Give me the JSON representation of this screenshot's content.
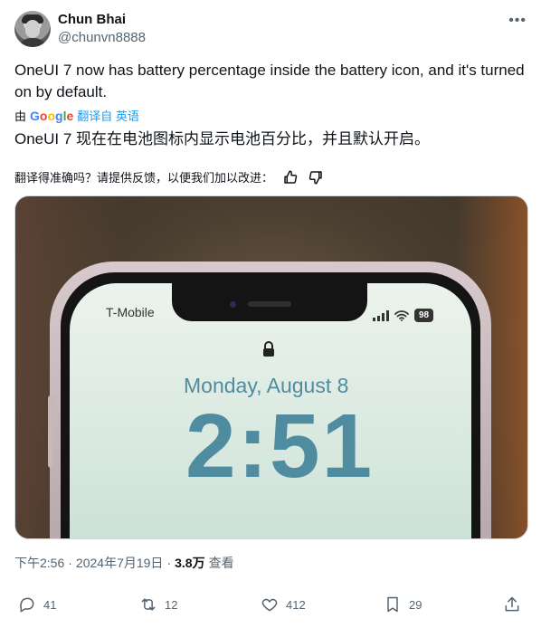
{
  "author": {
    "display_name": "Chun Bhai",
    "handle": "@chunvn8888"
  },
  "post": {
    "text_en": "OneUI 7 now has battery percentage inside the battery icon, and it's turned on by default.",
    "translated_by_prefix": "由",
    "translated_by_engine_letters": [
      "G",
      "o",
      "o",
      "g",
      "l",
      "e"
    ],
    "translated_from": "翻译自 英语",
    "text_zh": "OneUI 7 现在在电池图标内显示电池百分比，并且默认开启。",
    "feedback_prompt": "翻译得准确吗？请提供反馈，以便我们加以改进："
  },
  "media": {
    "carrier": "T-Mobile",
    "battery_percent": "98",
    "lock_date": "Monday, August 8",
    "lock_time": "2:51"
  },
  "meta": {
    "time": "下午2:56",
    "sep1": "·",
    "date": "2024年7月19日",
    "sep2": "·",
    "views_count": "3.8万",
    "views_label": "查看"
  },
  "actions": {
    "replies": "41",
    "reposts": "12",
    "likes": "412",
    "bookmarks": "29"
  },
  "colors": {
    "accent": "#1d9bf0",
    "secondary_text": "#536471",
    "primary_text": "#0f1419"
  },
  "icons": {
    "more": "more-dots-icon",
    "thumbs_up": "thumbs-up-icon",
    "thumbs_down": "thumbs-down-icon",
    "reply": "reply-icon",
    "repost": "repost-icon",
    "like": "heart-icon",
    "bookmark": "bookmark-icon",
    "share": "share-icon"
  }
}
